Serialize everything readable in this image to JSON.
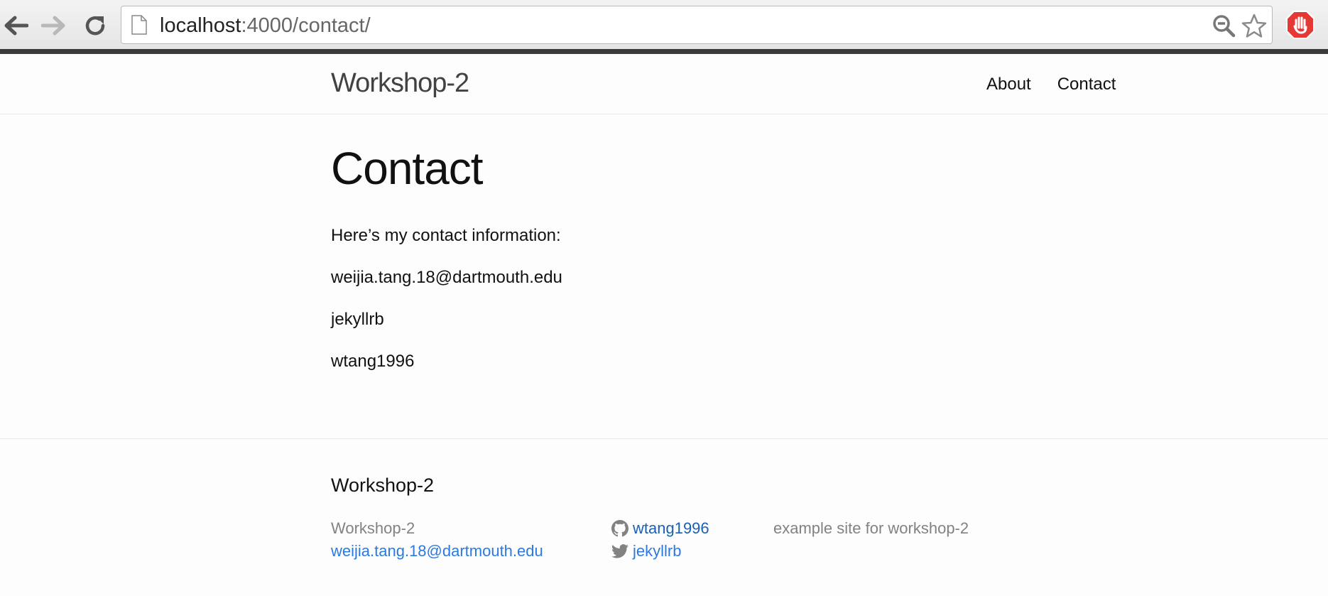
{
  "browser": {
    "url_host": "localhost",
    "url_path": ":4000/contact/",
    "icons": [
      "back-icon",
      "forward-icon",
      "reload-icon",
      "page-icon",
      "zoom-icon",
      "bookmark-star-icon",
      "adblock-icon"
    ]
  },
  "header": {
    "site_title": "Workshop-2",
    "nav": [
      "About",
      "Contact"
    ]
  },
  "main": {
    "title": "Contact",
    "paragraphs": [
      "Here’s my contact information:",
      "weijia.tang.18@dartmouth.edu",
      "jekyllrb",
      "wtang1996"
    ]
  },
  "footer": {
    "heading": "Workshop-2",
    "site_name": "Workshop-2",
    "email": "weijia.tang.18@dartmouth.edu",
    "github_username": "wtang1996",
    "twitter_username": "jekyllrb",
    "description": "example site for workshop-2"
  },
  "colors": {
    "link": "#2a7ae2",
    "muted_text": "#828282",
    "adblock_red": "#e53935"
  }
}
